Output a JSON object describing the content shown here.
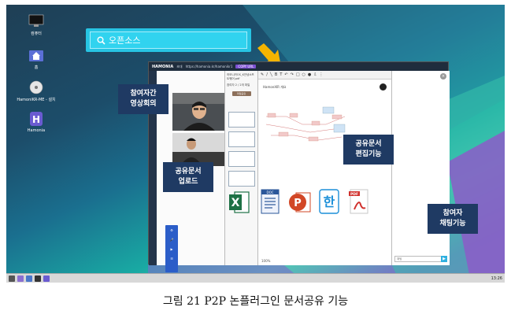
{
  "desktop": {
    "icons": [
      {
        "label": "컴퓨터",
        "icon": "monitor-icon"
      },
      {
        "label": "홈",
        "icon": "home-folder-icon"
      },
      {
        "label": "HamoniKR-ME - 설치",
        "icon": "disc-icon"
      },
      {
        "label": "Hamonia",
        "icon": "hamonia-app-icon"
      }
    ],
    "search": {
      "text": "오픈소스",
      "icon": "search-icon"
    }
  },
  "app": {
    "title_logo": "HAMONIA",
    "title_text": "초대",
    "url": "https://hamonia.kr/hamonikr1",
    "copy_button": "COPY URL",
    "doc_panel_header": "하모니카OS_K안녕소프트웨어.pdf",
    "doc_panel_sub": "참여자 2 / 2개 파일",
    "doc_panel_button": "파일공유",
    "doc_name": "HamoniKR 개요",
    "zoom": "100%",
    "chat_placeholder": "채팅",
    "file_icons": [
      "excel-icon",
      "word-doc-icon",
      "powerpoint-icon",
      "hangul-icon",
      "pdf-icon"
    ],
    "side_tools": [
      "설정",
      "마이크",
      "카메라",
      "참여자"
    ]
  },
  "callouts": {
    "video": [
      "참여자간",
      "영상회의"
    ],
    "upload": [
      "공유문서",
      "업로드"
    ],
    "edit": [
      "공유문서",
      "편집기능"
    ],
    "chat": [
      "참여자",
      "채팅기능"
    ]
  },
  "taskbar": {
    "clock": "13:26"
  },
  "caption": "그림 21 P2P 논플러그인 문서공유 기능",
  "colors": {
    "callout": "#1f3a63",
    "search": "#27c4e3",
    "arrow": "#f4b400"
  }
}
